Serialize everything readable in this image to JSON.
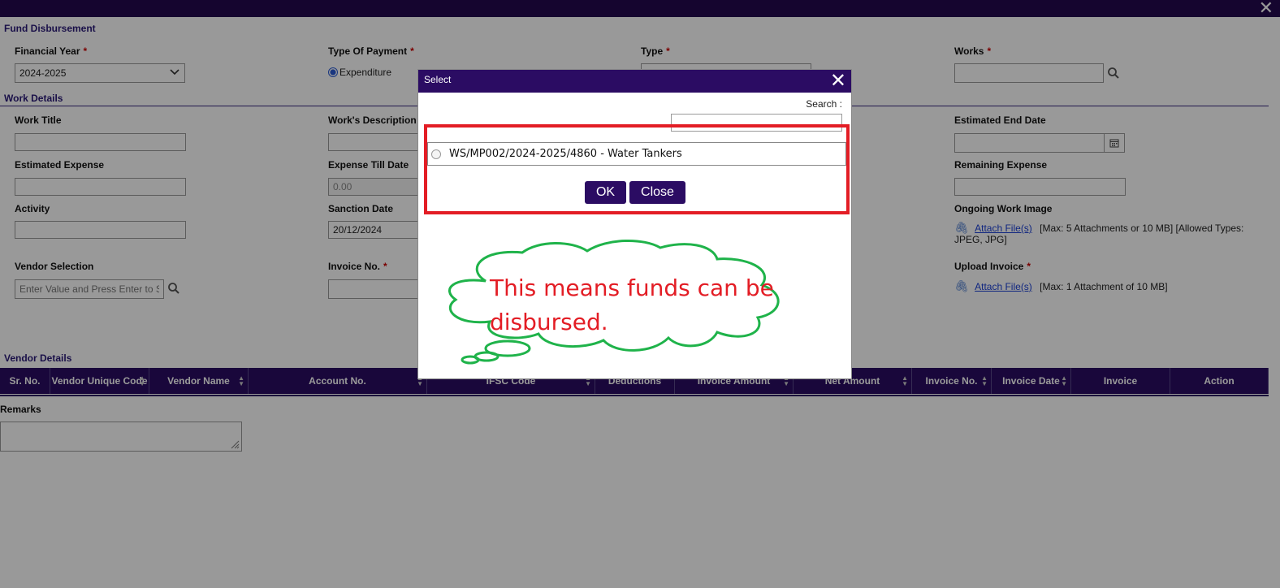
{
  "page": {
    "title": "Fund Disbursement",
    "close_glyph": "✕"
  },
  "form": {
    "financial_year": {
      "label": "Financial Year",
      "required": "*",
      "value": "2024-2025"
    },
    "type_of_payment": {
      "label": "Type Of Payment",
      "required": "*",
      "option_expenditure": "Expenditure"
    },
    "type": {
      "label": "Type",
      "required": "*"
    },
    "works": {
      "label": "Works",
      "required": "*"
    }
  },
  "work_details": {
    "title": "Work Details",
    "work_title": "Work Title",
    "works_description": "Work's Description",
    "estimated_end_date": "Estimated End Date",
    "estimated_expense": "Estimated Expense",
    "expense_till_date": {
      "label": "Expense Till Date",
      "value": "0.00"
    },
    "remaining_expense": "Remaining Expense",
    "activity": "Activity",
    "sanction_date": {
      "label": "Sanction Date",
      "value": "20/12/2024"
    },
    "ongoing_work_image": {
      "label": "Ongoing Work Image",
      "link": "Attach File(s)",
      "note": "[Max: 5 Attachments or 10 MB] [Allowed Types: JPEG, JPG]"
    },
    "vendor_selection": {
      "label": "Vendor Selection",
      "placeholder": "Enter Value and Press Enter to Search"
    },
    "invoice_no": {
      "label": "Invoice No.",
      "required": "*"
    },
    "upload_invoice": {
      "label": "Upload Invoice",
      "required": "*",
      "link": "Attach File(s)",
      "note": "[Max: 1 Attachment of 10 MB]"
    }
  },
  "vendor_details": {
    "title": "Vendor Details",
    "columns": [
      "Sr. No.",
      "Vendor Unique Code",
      "Vendor Name",
      "Account No.",
      "IFSC Code",
      "Deductions",
      "Invoice Amount",
      "Net Amount",
      "Invoice No.",
      "Invoice Date",
      "Invoice",
      "Action"
    ],
    "sortable": [
      false,
      true,
      true,
      true,
      true,
      false,
      true,
      true,
      true,
      true,
      false,
      false
    ]
  },
  "remarks": {
    "label": "Remarks"
  },
  "modal": {
    "title": "Select",
    "close_glyph": "✕",
    "search_label": "Search :",
    "items": [
      {
        "text": "WS/MP002/2024-2025/4860 - Water Tankers"
      }
    ],
    "ok_label": "OK",
    "close_label": "Close"
  },
  "annotation": {
    "callout_text": "This means funds can be disbursed.",
    "frame_color": "#e31d25",
    "cloud_color": "#1fb34a"
  },
  "colors": {
    "brand": "#2b0c63",
    "topbar": "#24094f"
  }
}
